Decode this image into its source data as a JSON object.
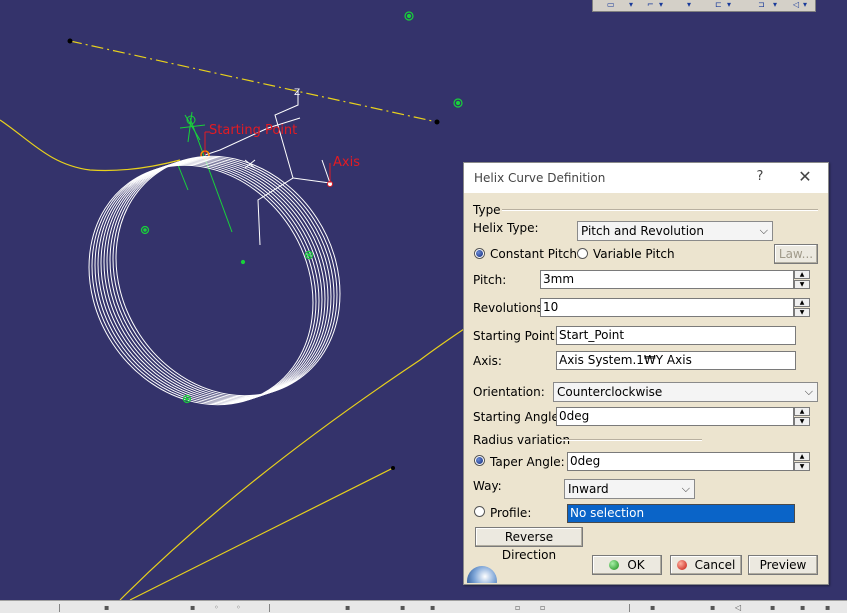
{
  "viewport": {
    "labels": {
      "starting_point": "Starting Point",
      "axis": "Axis"
    },
    "axis_glyph": "Z"
  },
  "dialog": {
    "title": "Helix Curve Definition",
    "help_label": "?",
    "close_label": "✕",
    "type_group": "Type",
    "helix_type_label": "Helix Type:",
    "helix_type_value": "Pitch and Revolution",
    "constant_pitch_label": "Constant Pitch",
    "variable_pitch_label": "Variable Pitch",
    "law_button": "Law...",
    "pitch_label": "Pitch:",
    "pitch_value": "3mm",
    "revolutions_label": "Revolutions:",
    "revolutions_value": "10",
    "starting_point_label": "Starting Point:",
    "starting_point_value": "Start_Point",
    "axis_label": "Axis:",
    "axis_value": "Axis System.1₩Y Axis",
    "orientation_label": "Orientation:",
    "orientation_value": "Counterclockwise",
    "starting_angle_label": "Starting Angle:",
    "starting_angle_value": "0deg",
    "radius_variation_group": "Radius variation",
    "taper_angle_label": "Taper Angle:",
    "taper_angle_value": "0deg",
    "way_label": "Way:",
    "way_value": "Inward",
    "profile_label": "Profile:",
    "profile_value": "No selection",
    "reverse_direction": "Reverse Direction",
    "ok": "OK",
    "cancel": "Cancel",
    "preview": "Preview"
  },
  "colors": {
    "background": "#34336b",
    "helix": "#ffffff",
    "curve": "#e8d11c",
    "points": "#18d23a",
    "label": "#e21b23",
    "profile_selected": "#0a64c8"
  }
}
